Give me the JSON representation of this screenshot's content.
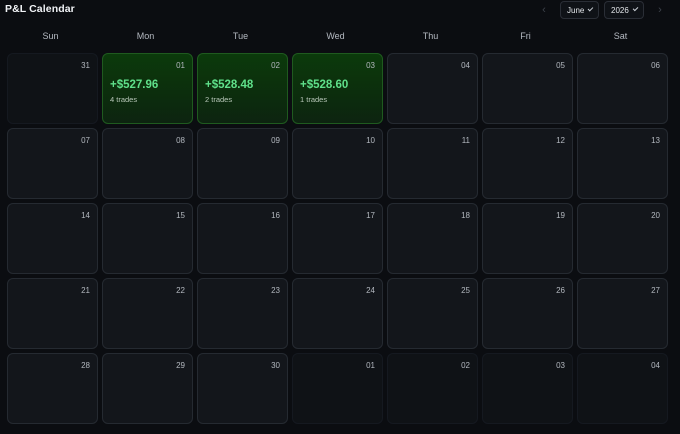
{
  "header": {
    "title": "P&L Calendar",
    "prev_icon": "chevron-left-icon",
    "next_icon": "chevron-right-icon",
    "month": "June",
    "year": "2026"
  },
  "weekdays": [
    "Sun",
    "Mon",
    "Tue",
    "Wed",
    "Thu",
    "Fri",
    "Sat"
  ],
  "weeks": [
    [
      {
        "day": "31",
        "other": true
      },
      {
        "day": "01",
        "pnl": "+$527.96",
        "trades": "4 trades"
      },
      {
        "day": "02",
        "pnl": "+$528.48",
        "trades": "2 trades"
      },
      {
        "day": "03",
        "pnl": "+$528.60",
        "trades": "1 trades"
      },
      {
        "day": "04"
      },
      {
        "day": "05"
      },
      {
        "day": "06"
      }
    ],
    [
      {
        "day": "07"
      },
      {
        "day": "08"
      },
      {
        "day": "09"
      },
      {
        "day": "10"
      },
      {
        "day": "11"
      },
      {
        "day": "12"
      },
      {
        "day": "13"
      }
    ],
    [
      {
        "day": "14"
      },
      {
        "day": "15"
      },
      {
        "day": "16"
      },
      {
        "day": "17"
      },
      {
        "day": "18"
      },
      {
        "day": "19"
      },
      {
        "day": "20"
      }
    ],
    [
      {
        "day": "21"
      },
      {
        "day": "22"
      },
      {
        "day": "23"
      },
      {
        "day": "24"
      },
      {
        "day": "25"
      },
      {
        "day": "26"
      },
      {
        "day": "27"
      }
    ],
    [
      {
        "day": "28"
      },
      {
        "day": "29"
      },
      {
        "day": "30"
      },
      {
        "day": "01",
        "other": true
      },
      {
        "day": "02",
        "other": true
      },
      {
        "day": "03",
        "other": true
      },
      {
        "day": "04",
        "other": true
      }
    ]
  ],
  "colors": {
    "background": "#0b0d11",
    "cell": "#13161b",
    "profit_cell": "#0c2d0d",
    "profit_text": "#5fe08a"
  }
}
